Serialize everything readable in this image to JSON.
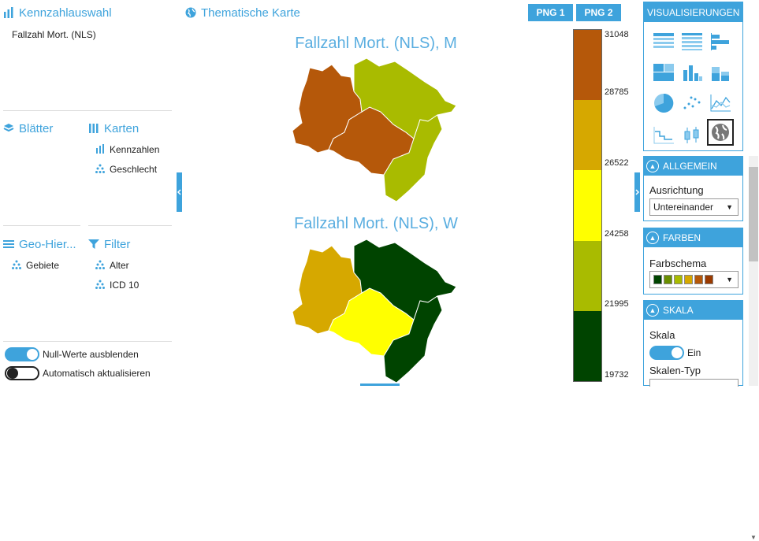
{
  "left": {
    "kennzahl_title": "Kennzahlauswahl",
    "kennzahl_selected": "Fallzahl Mort. (NLS)",
    "blaetter_title": "Blätter",
    "karten_title": "Karten",
    "karten_items": [
      "Kennzahlen",
      "Geschlecht"
    ],
    "geo_title": "Geo-Hier...",
    "geo_items": [
      "Gebiete"
    ],
    "filter_title": "Filter",
    "filter_items": [
      "Alter",
      "ICD 10"
    ],
    "toggle_null_label": "Null-Werte ausblenden",
    "toggle_null_on": true,
    "toggle_auto_label": "Automatisch aktualisieren",
    "toggle_auto_on": false
  },
  "center": {
    "title": "Thematische Karte",
    "png1": "PNG 1",
    "png2": "PNG 2",
    "map1_title": "Fallzahl Mort. (NLS), M",
    "map2_title": "Fallzahl Mort. (NLS), W",
    "map1_region_colors": [
      "#b5580a",
      "#b5580a",
      "#a9bb00",
      "#a9bb00"
    ],
    "map2_region_colors": [
      "#d6a800",
      "#ffff00",
      "#004400",
      "#004400"
    ],
    "legend_labels": [
      "31048",
      "28785",
      "26522",
      "24258",
      "21995",
      "19732"
    ],
    "legend_colors": [
      "#b5580a",
      "#d6a800",
      "#ffff00",
      "#a9bb00",
      "#004400"
    ]
  },
  "right": {
    "vis_title": "VISUALISIERUNGEN",
    "vis_icons": [
      "table-icon",
      "list-table-icon",
      "horizontal-bar-icon",
      "treemap-icon",
      "bar-chart-icon",
      "stacked-bar-icon",
      "pie-chart-icon",
      "scatter-icon",
      "line-chart-icon",
      "step-chart-icon",
      "boxplot-icon",
      "globe-map-icon"
    ],
    "allgemein_title": "ALLGEMEIN",
    "ausrichtung_label": "Ausrichtung",
    "ausrichtung_value": "Untereinander",
    "farben_title": "FARBEN",
    "farbschema_label": "Farbschema",
    "farbschema_colors": [
      "#004400",
      "#6a8f00",
      "#a9bb00",
      "#d6a800",
      "#b5580a",
      "#9a3a00"
    ],
    "skala_title": "SKALA",
    "skala_label": "Skala",
    "skala_toggle_label": "Ein",
    "skalen_typ_label": "Skalen-Typ"
  }
}
